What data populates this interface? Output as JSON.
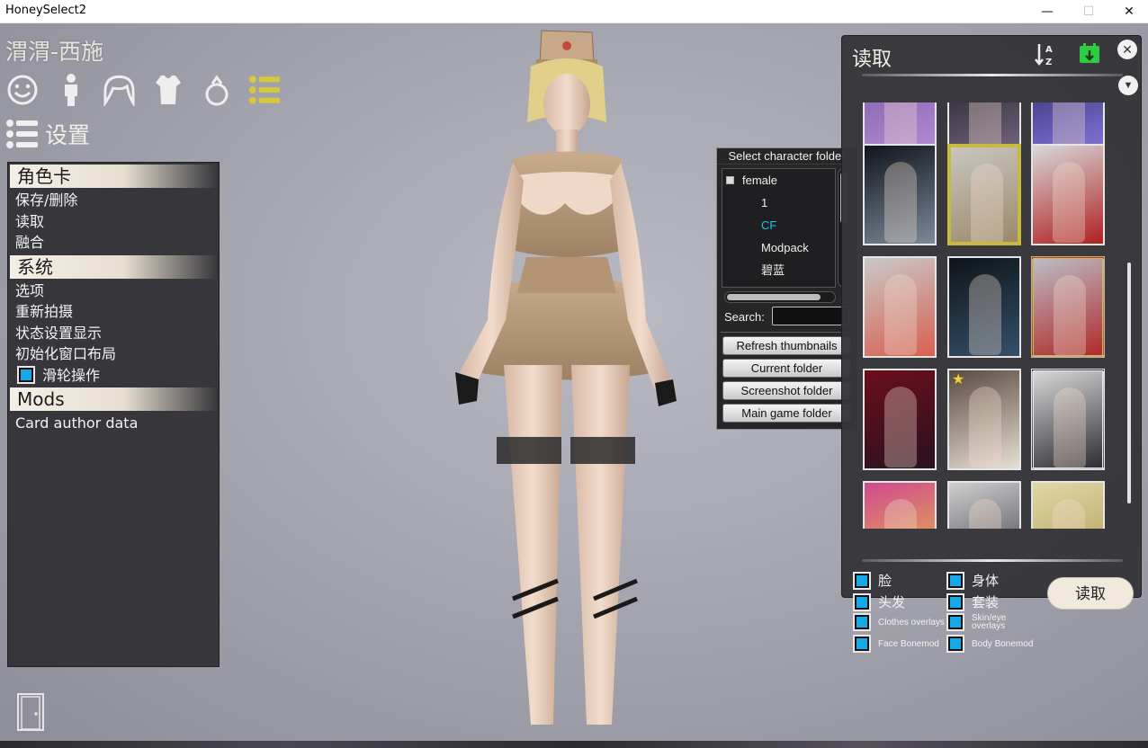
{
  "window": {
    "title": "HoneySelect2",
    "minimize": "—",
    "maximize": "☐",
    "close": "✕"
  },
  "character": {
    "name": "渭渭-西施"
  },
  "category_icons": [
    "face-icon",
    "body-icon",
    "hair-icon",
    "clothes-icon",
    "accessory-icon",
    "system-menu-icon"
  ],
  "settings": {
    "label": "设置"
  },
  "left_menu": {
    "sections": [
      {
        "header": "角色卡",
        "items": [
          "保存/删除",
          "读取",
          "融合"
        ]
      },
      {
        "header": "系统",
        "items": [
          "选项",
          "重新拍摄",
          "状态设置显示",
          "初始化窗口布局"
        ],
        "check_item": "滑轮操作"
      },
      {
        "header": "Mods",
        "items": [
          "Card author data"
        ]
      }
    ]
  },
  "folder_panel": {
    "title": "Select character folder",
    "tree": {
      "root": "female",
      "children": [
        "1",
        "CF",
        "Modpack",
        "碧蓝"
      ],
      "selected": "CF"
    },
    "search_label": "Search:",
    "search_value": "",
    "buttons": [
      "Refresh thumbnails",
      "Current folder",
      "Screenshot folder",
      "Main game folder"
    ]
  },
  "load_panel": {
    "title": "读取",
    "close": "✕",
    "dropdown": "▼",
    "thumbnails": [
      {
        "id": "t1",
        "palette": [
          "#7a5aa6",
          "#b98fd8"
        ]
      },
      {
        "id": "t2",
        "palette": [
          "#1c1c24",
          "#7a6a86"
        ]
      },
      {
        "id": "t3",
        "palette": [
          "#2a2a6a",
          "#8a7ae0"
        ]
      },
      {
        "id": "t4",
        "palette": [
          "#10141c",
          "#7a8a9a"
        ]
      },
      {
        "id": "t5",
        "palette": [
          "#c9c6c0",
          "#9a8a6a"
        ],
        "selected": true
      },
      {
        "id": "t6",
        "palette": [
          "#d8d8d8",
          "#b02020"
        ]
      },
      {
        "id": "t7",
        "palette": [
          "#c9c9c9",
          "#d86050"
        ]
      },
      {
        "id": "t8",
        "palette": [
          "#0e1418",
          "#34506a"
        ]
      },
      {
        "id": "t9",
        "palette": [
          "#bcbcc4",
          "#b02a2a"
        ],
        "ornate": true
      },
      {
        "id": "t10",
        "palette": [
          "#6a0f1a",
          "#2a1020"
        ]
      },
      {
        "id": "t11",
        "palette": [
          "#5a4a40",
          "#e8e0d4"
        ],
        "star": true
      },
      {
        "id": "t12",
        "palette": [
          "#d8d8d8",
          "#2c2c34"
        ],
        "ornate2": true
      },
      {
        "id": "t13",
        "palette": [
          "#d04a90",
          "#e8c040"
        ]
      },
      {
        "id": "t14",
        "palette": [
          "#cfcfcf",
          "#3a3a44"
        ]
      },
      {
        "id": "t15",
        "palette": [
          "#e0d8a8",
          "#b09a50"
        ]
      }
    ],
    "options": [
      {
        "label": "脸",
        "size": "big"
      },
      {
        "label": "身体",
        "size": "big"
      },
      {
        "label": "头发",
        "size": "big"
      },
      {
        "label": "套装",
        "size": "big"
      },
      {
        "label": "Clothes overlays",
        "size": "small"
      },
      {
        "label": "Skin/eye overlays",
        "size": "small"
      },
      {
        "label": "Face Bonemod",
        "size": "small"
      },
      {
        "label": "Body Bonemod",
        "size": "small"
      }
    ],
    "load_button": "读取"
  },
  "colors": {
    "accent": "#14a8e6",
    "selected_folder": "#1cc6e8",
    "selected_thumb": "#c7ba3c",
    "calendar_green": "#2ecc40",
    "menu_icon_active": "#d8c93a"
  }
}
